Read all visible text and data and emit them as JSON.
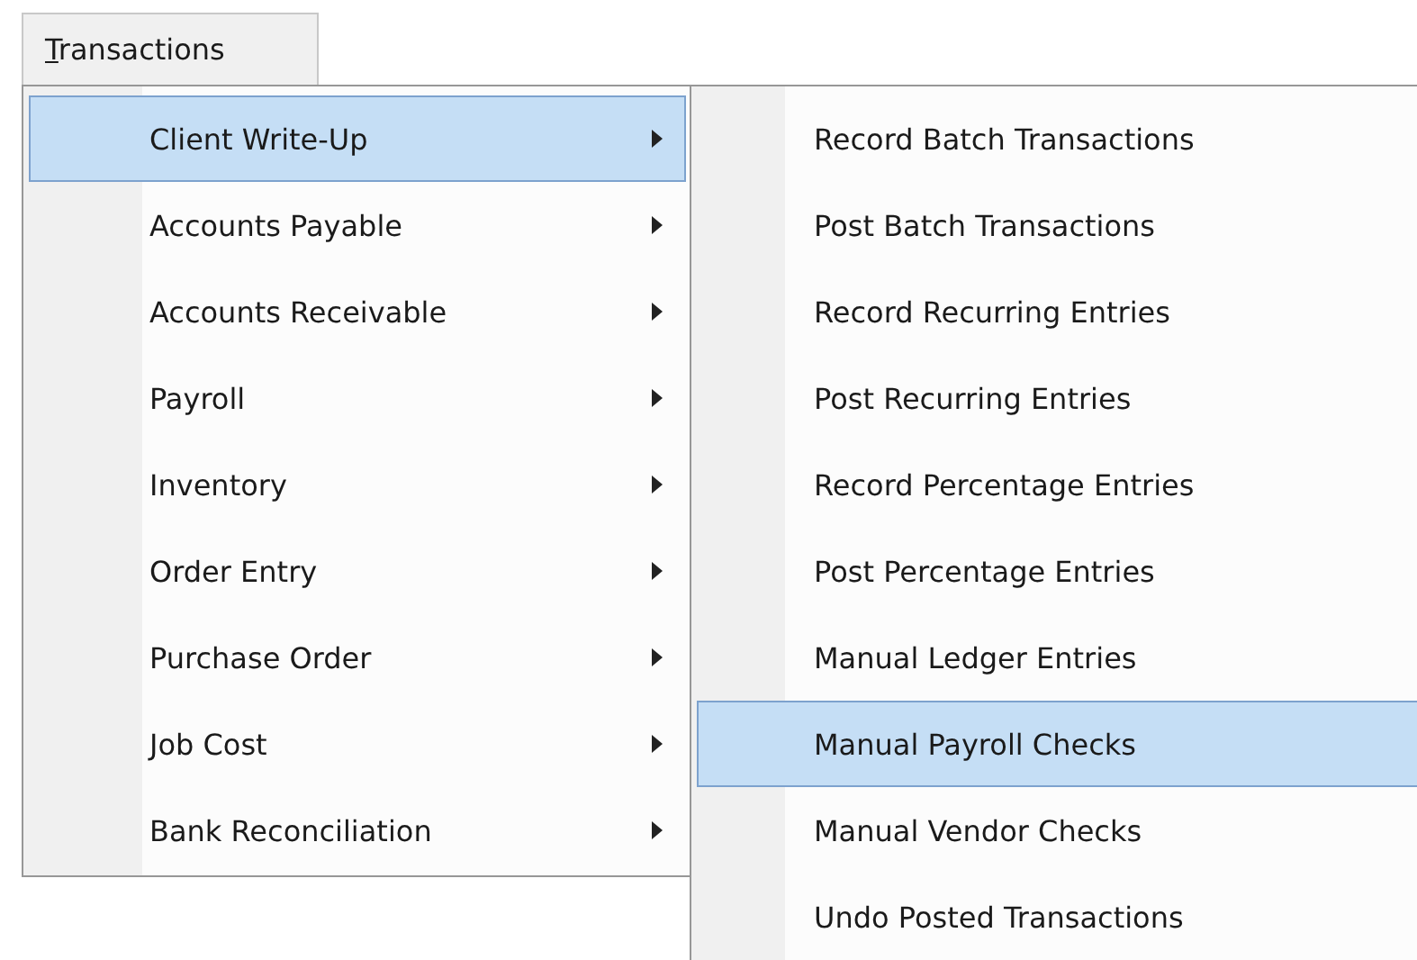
{
  "menu_bar": [
    {
      "label": "Transactions",
      "open": true
    }
  ],
  "menu": {
    "items": [
      {
        "label": "Client Write-Up",
        "selected": true,
        "has_submenu": true
      },
      {
        "label": "Accounts Payable",
        "selected": false,
        "has_submenu": true
      },
      {
        "label": "Accounts Receivable",
        "selected": false,
        "has_submenu": true
      },
      {
        "label": "Payroll",
        "selected": false,
        "has_submenu": true
      },
      {
        "label": "Inventory",
        "selected": false,
        "has_submenu": true
      },
      {
        "label": "Order Entry",
        "selected": false,
        "has_submenu": true
      },
      {
        "label": "Purchase Order",
        "selected": false,
        "has_submenu": true
      },
      {
        "label": "Job Cost",
        "selected": false,
        "has_submenu": true
      },
      {
        "label": "Bank Reconciliation",
        "selected": false,
        "has_submenu": true
      }
    ]
  },
  "submenu": {
    "items": [
      {
        "label": "Record Batch Transactions",
        "selected": false
      },
      {
        "label": "Post Batch Transactions",
        "selected": false
      },
      {
        "label": "Record Recurring Entries",
        "selected": false
      },
      {
        "label": "Post Recurring Entries",
        "selected": false
      },
      {
        "label": "Record Percentage Entries",
        "selected": false
      },
      {
        "label": "Post Percentage Entries",
        "selected": false
      },
      {
        "label": "Manual Ledger Entries",
        "selected": false
      },
      {
        "label": "Manual Payroll Checks",
        "selected": true
      },
      {
        "label": "Manual Vendor Checks",
        "selected": false
      },
      {
        "label": "Undo Posted Transactions",
        "selected": false
      }
    ]
  }
}
